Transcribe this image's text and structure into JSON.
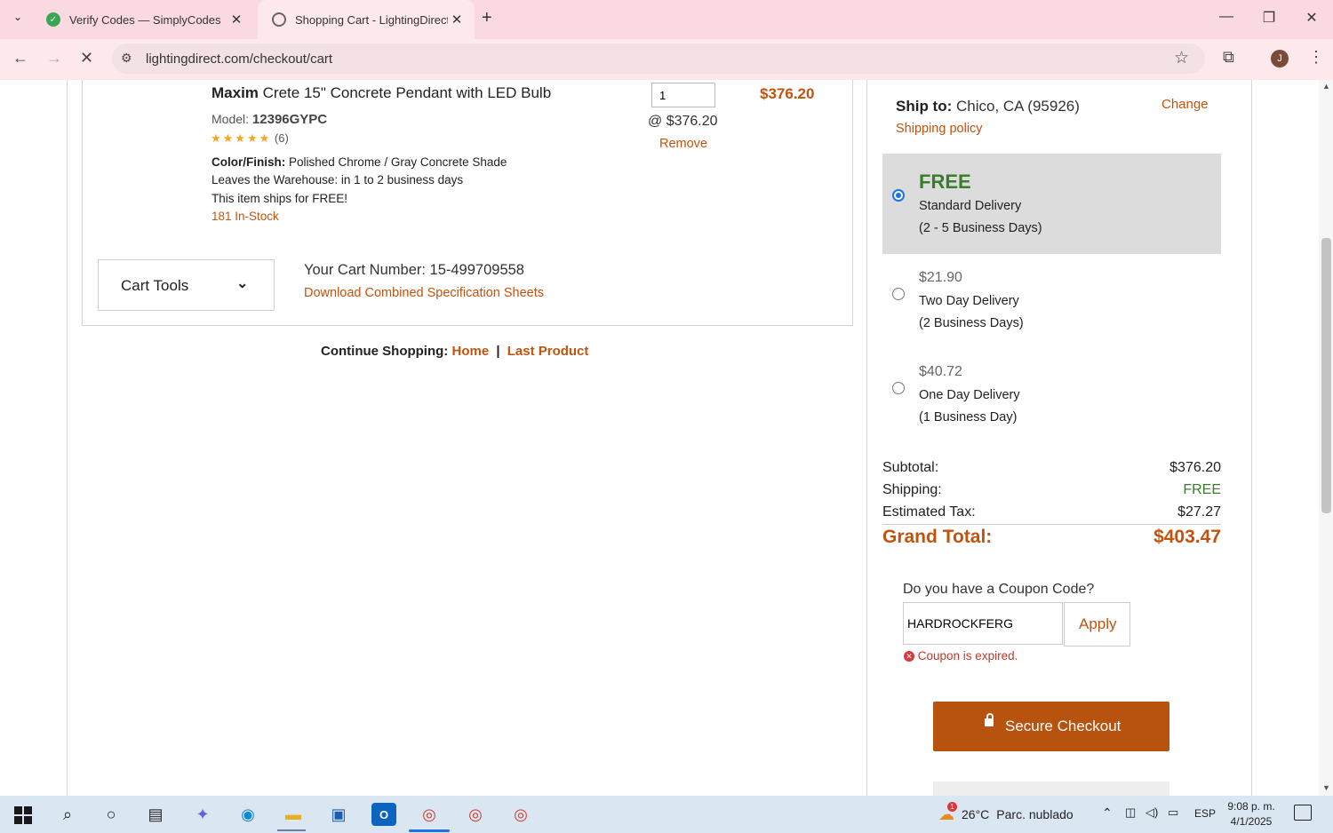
{
  "browser": {
    "tabs": [
      {
        "title": "Verify Codes — SimplyCodes"
      },
      {
        "title": "Shopping Cart - LightingDirect.c"
      }
    ],
    "url": "lightingdirect.com/checkout/cart",
    "profile_initial": "J"
  },
  "product": {
    "brand": "Maxim",
    "name": "Crete 15\" Concrete Pendant with LED Bulb",
    "model_label": "Model:",
    "model": "12396GYPC",
    "stars": "★★★★★",
    "rating_count": "(6)",
    "color_label": "Color/Finish:",
    "color_value": "Polished Chrome / Gray Concrete Shade",
    "warehouse": "Leaves the Warehouse: in 1 to 2 business days",
    "ships_free": "This item ships for FREE!",
    "stock": "181 In-Stock",
    "quantity": "1",
    "unit_price": "@ $376.20",
    "remove": "Remove",
    "line_total": "$376.20"
  },
  "cart": {
    "tools_label": "Cart Tools",
    "number_text": "Your Cart Number: 15-499709558",
    "download_link": "Download Combined Specification Sheets",
    "continue_label": "Continue Shopping:",
    "home_link": "Home",
    "separator": "|",
    "last_product_link": "Last Product"
  },
  "shipping": {
    "ship_to_label": "Ship to:",
    "ship_to_value": "Chico, CA (95926)",
    "change": "Change",
    "policy": "Shipping policy",
    "options": [
      {
        "price": "FREE",
        "name": "Standard Delivery",
        "days": "(2 - 5 Business Days)",
        "selected": true
      },
      {
        "price": "$21.90",
        "name": "Two Day Delivery",
        "days": "(2 Business Days)",
        "selected": false
      },
      {
        "price": "$40.72",
        "name": "One Day Delivery",
        "days": "(1 Business Day)",
        "selected": false
      }
    ]
  },
  "summary": {
    "subtotal_label": "Subtotal:",
    "subtotal": "$376.20",
    "shipping_label": "Shipping:",
    "shipping": "FREE",
    "tax_label": "Estimated Tax:",
    "tax": "$27.27",
    "grand_label": "Grand Total:",
    "grand": "$403.47"
  },
  "coupon": {
    "question": "Do you have a Coupon Code?",
    "value": "HARDROCKFERG",
    "apply": "Apply",
    "error": "Coupon is expired."
  },
  "checkout": {
    "label": "Secure Checkout"
  },
  "taskbar": {
    "weather_temp": "26°C",
    "weather_desc": "Parc. nublado",
    "lang": "ESP",
    "time": "9:08 p. m.",
    "date": "4/1/2025",
    "weather_badge": "1"
  },
  "colors": {
    "accent": "#c2530f",
    "free_green": "#3a7d2c",
    "checkout_bg": "#b8520f",
    "tab_bg": "#fbd9e0"
  }
}
